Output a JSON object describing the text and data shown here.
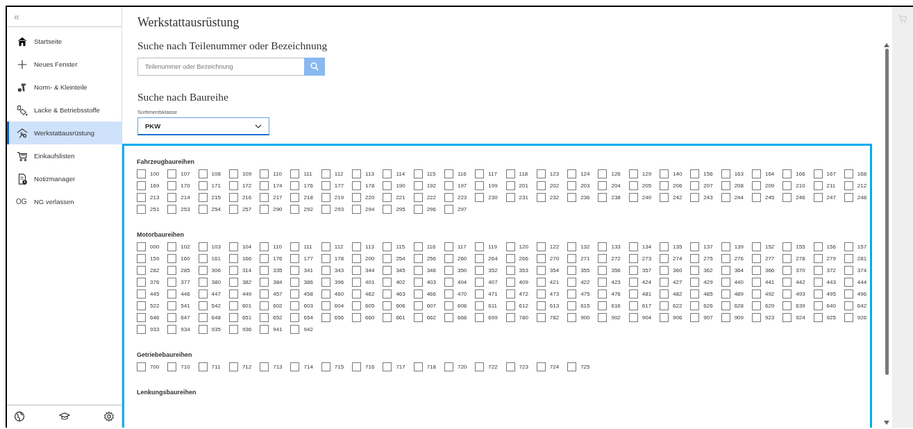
{
  "sidebar": {
    "collapse": "«",
    "items": [
      {
        "label": "Startseite",
        "selected": false
      },
      {
        "label": "Neues Fenster",
        "selected": false
      },
      {
        "label": "Norm- & Kleinteile",
        "selected": false
      },
      {
        "label": "Lacke & Betriebsstoffe",
        "selected": false
      },
      {
        "label": "Werkstattausrüstung",
        "selected": true
      },
      {
        "label": "Einkaufslisten",
        "selected": false
      },
      {
        "label": "Notizmanager",
        "selected": false
      },
      {
        "label": "NG verlassen",
        "badge": "OG",
        "selected": false
      }
    ]
  },
  "page_title": "Werkstattausrüstung",
  "part_search": {
    "heading": "Suche nach Teilenummer oder Bezeichnung",
    "placeholder": "Teilenummer oder Bezeichnung"
  },
  "series_search": {
    "heading": "Suche nach Baureihe",
    "select_label": "Sortimentsklasse",
    "select_value": "PKW"
  },
  "groups": [
    {
      "heading": "Fahrzeugbaureihen",
      "options": [
        {
          "label": "100",
          "checked": false
        },
        {
          "label": "107",
          "checked": false
        },
        {
          "label": "108",
          "checked": false
        },
        {
          "label": "109",
          "checked": false
        },
        {
          "label": "110",
          "checked": false
        },
        {
          "label": "111",
          "checked": false
        },
        {
          "label": "112",
          "checked": false
        },
        {
          "label": "113",
          "checked": false
        },
        {
          "label": "114",
          "checked": false
        },
        {
          "label": "115",
          "checked": false
        },
        {
          "label": "116",
          "checked": false
        },
        {
          "label": "117",
          "checked": false
        },
        {
          "label": "118",
          "checked": false
        },
        {
          "label": "123",
          "checked": false
        },
        {
          "label": "124",
          "checked": false
        },
        {
          "label": "126",
          "checked": false
        },
        {
          "label": "129",
          "checked": false
        },
        {
          "label": "140",
          "checked": false
        },
        {
          "label": "156",
          "checked": false
        },
        {
          "label": "163",
          "checked": false
        },
        {
          "label": "164",
          "checked": false
        },
        {
          "label": "166",
          "checked": false
        },
        {
          "label": "167",
          "checked": false
        },
        {
          "label": "168",
          "checked": false
        },
        {
          "label": "169",
          "checked": false
        },
        {
          "label": "170",
          "checked": false
        },
        {
          "label": "171",
          "checked": false
        },
        {
          "label": "172",
          "checked": false
        },
        {
          "label": "174",
          "checked": false
        },
        {
          "label": "176",
          "checked": false
        },
        {
          "label": "177",
          "checked": false
        },
        {
          "label": "178",
          "checked": false
        },
        {
          "label": "190",
          "checked": false
        },
        {
          "label": "192",
          "checked": false
        },
        {
          "label": "197",
          "checked": false
        },
        {
          "label": "199",
          "checked": false
        },
        {
          "label": "201",
          "checked": false
        },
        {
          "label": "202",
          "checked": false
        },
        {
          "label": "203",
          "checked": false
        },
        {
          "label": "204",
          "checked": false
        },
        {
          "label": "205",
          "checked": false
        },
        {
          "label": "206",
          "checked": false
        },
        {
          "label": "207",
          "checked": false
        },
        {
          "label": "208",
          "checked": false
        },
        {
          "label": "209",
          "checked": false
        },
        {
          "label": "210",
          "checked": false
        },
        {
          "label": "211",
          "checked": false
        },
        {
          "label": "212",
          "checked": false
        },
        {
          "label": "213",
          "checked": false
        },
        {
          "label": "214",
          "checked": false
        },
        {
          "label": "215",
          "checked": false
        },
        {
          "label": "216",
          "checked": false
        },
        {
          "label": "217",
          "checked": false
        },
        {
          "label": "218",
          "checked": false
        },
        {
          "label": "219",
          "checked": false
        },
        {
          "label": "220",
          "checked": false
        },
        {
          "label": "221",
          "checked": false
        },
        {
          "label": "222",
          "checked": false
        },
        {
          "label": "223",
          "checked": false
        },
        {
          "label": "230",
          "checked": false
        },
        {
          "label": "231",
          "checked": false
        },
        {
          "label": "232",
          "checked": false
        },
        {
          "label": "236",
          "checked": false
        },
        {
          "label": "238",
          "checked": false
        },
        {
          "label": "240",
          "checked": false
        },
        {
          "label": "242",
          "checked": false
        },
        {
          "label": "243",
          "checked": false
        },
        {
          "label": "244",
          "checked": false
        },
        {
          "label": "245",
          "checked": false
        },
        {
          "label": "246",
          "checked": false
        },
        {
          "label": "247",
          "checked": false
        },
        {
          "label": "248",
          "checked": false
        },
        {
          "label": "251",
          "checked": false
        },
        {
          "label": "253",
          "checked": false
        },
        {
          "label": "254",
          "checked": false
        },
        {
          "label": "257",
          "checked": false
        },
        {
          "label": "290",
          "checked": false
        },
        {
          "label": "292",
          "checked": false
        },
        {
          "label": "293",
          "checked": false
        },
        {
          "label": "294",
          "checked": false
        },
        {
          "label": "295",
          "checked": false
        },
        {
          "label": "296",
          "checked": false
        },
        {
          "label": "297",
          "checked": false
        }
      ]
    },
    {
      "heading": "Motorbaureihen",
      "options": [
        {
          "label": "000",
          "checked": false
        },
        {
          "label": "102",
          "checked": false
        },
        {
          "label": "103",
          "checked": false
        },
        {
          "label": "104",
          "checked": false
        },
        {
          "label": "110",
          "checked": false
        },
        {
          "label": "111",
          "checked": false
        },
        {
          "label": "112",
          "checked": false
        },
        {
          "label": "113",
          "checked": false
        },
        {
          "label": "115",
          "checked": false
        },
        {
          "label": "116",
          "checked": false
        },
        {
          "label": "117",
          "checked": false
        },
        {
          "label": "119",
          "checked": false
        },
        {
          "label": "120",
          "checked": false
        },
        {
          "label": "122",
          "checked": false
        },
        {
          "label": "132",
          "checked": false
        },
        {
          "label": "133",
          "checked": false
        },
        {
          "label": "134",
          "checked": false
        },
        {
          "label": "135",
          "checked": false
        },
        {
          "label": "137",
          "checked": false
        },
        {
          "label": "139",
          "checked": false
        },
        {
          "label": "152",
          "checked": false
        },
        {
          "label": "155",
          "checked": false
        },
        {
          "label": "156",
          "checked": false
        },
        {
          "label": "157",
          "checked": false
        },
        {
          "label": "159",
          "checked": false
        },
        {
          "label": "160",
          "checked": false
        },
        {
          "label": "161",
          "checked": false
        },
        {
          "label": "166",
          "checked": false
        },
        {
          "label": "176",
          "checked": false
        },
        {
          "label": "177",
          "checked": false
        },
        {
          "label": "178",
          "checked": false
        },
        {
          "label": "200",
          "checked": false
        },
        {
          "label": "254",
          "checked": false
        },
        {
          "label": "256",
          "checked": false
        },
        {
          "label": "260",
          "checked": false
        },
        {
          "label": "264",
          "checked": false
        },
        {
          "label": "266",
          "checked": false
        },
        {
          "label": "270",
          "checked": false
        },
        {
          "label": "271",
          "checked": false
        },
        {
          "label": "272",
          "checked": false
        },
        {
          "label": "273",
          "checked": false
        },
        {
          "label": "274",
          "checked": false
        },
        {
          "label": "275",
          "checked": false
        },
        {
          "label": "276",
          "checked": false
        },
        {
          "label": "277",
          "checked": false
        },
        {
          "label": "278",
          "checked": false
        },
        {
          "label": "279",
          "checked": false
        },
        {
          "label": "281",
          "checked": false
        },
        {
          "label": "282",
          "checked": false
        },
        {
          "label": "285",
          "checked": false
        },
        {
          "label": "306",
          "checked": false
        },
        {
          "label": "314",
          "checked": false
        },
        {
          "label": "335",
          "checked": false
        },
        {
          "label": "341",
          "checked": false
        },
        {
          "label": "343",
          "checked": false
        },
        {
          "label": "344",
          "checked": false
        },
        {
          "label": "345",
          "checked": false
        },
        {
          "label": "346",
          "checked": false
        },
        {
          "label": "350",
          "checked": false
        },
        {
          "label": "352",
          "checked": false
        },
        {
          "label": "353",
          "checked": false
        },
        {
          "label": "354",
          "checked": false
        },
        {
          "label": "355",
          "checked": false
        },
        {
          "label": "356",
          "checked": false
        },
        {
          "label": "357",
          "checked": false
        },
        {
          "label": "360",
          "checked": false
        },
        {
          "label": "362",
          "checked": false
        },
        {
          "label": "364",
          "checked": false
        },
        {
          "label": "366",
          "checked": false
        },
        {
          "label": "370",
          "checked": false
        },
        {
          "label": "372",
          "checked": false
        },
        {
          "label": "374",
          "checked": false
        },
        {
          "label": "376",
          "checked": false
        },
        {
          "label": "377",
          "checked": false
        },
        {
          "label": "380",
          "checked": false
        },
        {
          "label": "382",
          "checked": false
        },
        {
          "label": "384",
          "checked": false
        },
        {
          "label": "386",
          "checked": false
        },
        {
          "label": "396",
          "checked": false
        },
        {
          "label": "401",
          "checked": false
        },
        {
          "label": "402",
          "checked": false
        },
        {
          "label": "403",
          "checked": false
        },
        {
          "label": "404",
          "checked": false
        },
        {
          "label": "407",
          "checked": false
        },
        {
          "label": "409",
          "checked": false
        },
        {
          "label": "421",
          "checked": false
        },
        {
          "label": "422",
          "checked": false
        },
        {
          "label": "423",
          "checked": false
        },
        {
          "label": "424",
          "checked": false
        },
        {
          "label": "427",
          "checked": false
        },
        {
          "label": "429",
          "checked": false
        },
        {
          "label": "440",
          "checked": false
        },
        {
          "label": "441",
          "checked": false
        },
        {
          "label": "442",
          "checked": false
        },
        {
          "label": "443",
          "checked": false
        },
        {
          "label": "444",
          "checked": false
        },
        {
          "label": "445",
          "checked": false
        },
        {
          "label": "446",
          "checked": false
        },
        {
          "label": "447",
          "checked": false
        },
        {
          "label": "449",
          "checked": false
        },
        {
          "label": "457",
          "checked": false
        },
        {
          "label": "458",
          "checked": false
        },
        {
          "label": "460",
          "checked": false
        },
        {
          "label": "462",
          "checked": false
        },
        {
          "label": "463",
          "checked": false
        },
        {
          "label": "466",
          "checked": false
        },
        {
          "label": "470",
          "checked": false
        },
        {
          "label": "471",
          "checked": false
        },
        {
          "label": "472",
          "checked": false
        },
        {
          "label": "473",
          "checked": false
        },
        {
          "label": "475",
          "checked": false
        },
        {
          "label": "476",
          "checked": false
        },
        {
          "label": "481",
          "checked": false
        },
        {
          "label": "482",
          "checked": false
        },
        {
          "label": "485",
          "checked": false
        },
        {
          "label": "489",
          "checked": false
        },
        {
          "label": "492",
          "checked": false
        },
        {
          "label": "493",
          "checked": false
        },
        {
          "label": "495",
          "checked": false
        },
        {
          "label": "496",
          "checked": false
        },
        {
          "label": "522",
          "checked": false
        },
        {
          "label": "541",
          "checked": false
        },
        {
          "label": "542",
          "checked": false
        },
        {
          "label": "601",
          "checked": false
        },
        {
          "label": "602",
          "checked": false
        },
        {
          "label": "603",
          "checked": false
        },
        {
          "label": "604",
          "checked": false
        },
        {
          "label": "605",
          "checked": false
        },
        {
          "label": "606",
          "checked": false
        },
        {
          "label": "607",
          "checked": false
        },
        {
          "label": "608",
          "checked": false
        },
        {
          "label": "611",
          "checked": false
        },
        {
          "label": "612",
          "checked": false
        },
        {
          "label": "613",
          "checked": false
        },
        {
          "label": "615",
          "checked": false
        },
        {
          "label": "616",
          "checked": false
        },
        {
          "label": "617",
          "checked": false
        },
        {
          "label": "622",
          "checked": false
        },
        {
          "label": "626",
          "checked": false
        },
        {
          "label": "628",
          "checked": false
        },
        {
          "label": "629",
          "checked": false
        },
        {
          "label": "639",
          "checked": false
        },
        {
          "label": "640",
          "checked": false
        },
        {
          "label": "642",
          "checked": false
        },
        {
          "label": "646",
          "checked": false
        },
        {
          "label": "647",
          "checked": false
        },
        {
          "label": "648",
          "checked": false
        },
        {
          "label": "651",
          "checked": false
        },
        {
          "label": "652",
          "checked": false
        },
        {
          "label": "654",
          "checked": false
        },
        {
          "label": "656",
          "checked": false
        },
        {
          "label": "660",
          "checked": false
        },
        {
          "label": "661",
          "checked": false
        },
        {
          "label": "662",
          "checked": false
        },
        {
          "label": "668",
          "checked": false
        },
        {
          "label": "699",
          "checked": false
        },
        {
          "label": "780",
          "checked": false
        },
        {
          "label": "782",
          "checked": false
        },
        {
          "label": "900",
          "checked": false
        },
        {
          "label": "902",
          "checked": false
        },
        {
          "label": "904",
          "checked": false
        },
        {
          "label": "906",
          "checked": false
        },
        {
          "label": "907",
          "checked": false
        },
        {
          "label": "909",
          "checked": false
        },
        {
          "label": "923",
          "checked": false
        },
        {
          "label": "924",
          "checked": false
        },
        {
          "label": "925",
          "checked": false
        },
        {
          "label": "926",
          "checked": false
        },
        {
          "label": "933",
          "checked": false
        },
        {
          "label": "934",
          "checked": false
        },
        {
          "label": "935",
          "checked": false
        },
        {
          "label": "936",
          "checked": false
        },
        {
          "label": "941",
          "checked": false
        },
        {
          "label": "942",
          "checked": false
        }
      ]
    },
    {
      "heading": "Getriebebaureihen",
      "options": [
        {
          "label": "700",
          "checked": false
        },
        {
          "label": "710",
          "checked": false
        },
        {
          "label": "711",
          "checked": false
        },
        {
          "label": "712",
          "checked": false
        },
        {
          "label": "713",
          "checked": false
        },
        {
          "label": "714",
          "checked": false
        },
        {
          "label": "715",
          "checked": false
        },
        {
          "label": "716",
          "checked": false
        },
        {
          "label": "717",
          "checked": false
        },
        {
          "label": "718",
          "checked": false
        },
        {
          "label": "720",
          "checked": false
        },
        {
          "label": "722",
          "checked": false
        },
        {
          "label": "723",
          "checked": false
        },
        {
          "label": "724",
          "checked": false
        },
        {
          "label": "725",
          "checked": false
        }
      ]
    },
    {
      "heading": "Lenkungsbaureihen"
    }
  ]
}
